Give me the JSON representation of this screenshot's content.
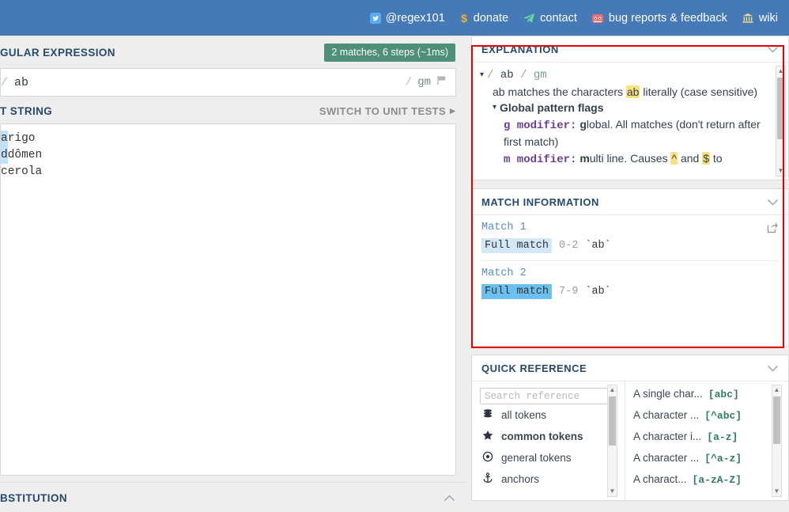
{
  "topnav": {
    "links": [
      {
        "icon": "twitter-icon",
        "label": "@regex101"
      },
      {
        "icon": "dollar-icon",
        "label": "donate"
      },
      {
        "icon": "telegram-icon",
        "label": "contact"
      },
      {
        "icon": "github-icon",
        "label": "bug reports & feedback"
      },
      {
        "icon": "bank-icon",
        "label": "wiki"
      }
    ]
  },
  "regex_section": {
    "title": "GULAR EXPRESSION",
    "match_badge": "2 matches, 6 steps (~1ms)",
    "slash": "/",
    "pattern": "ab",
    "flags_slash": "/",
    "flags": "gm",
    "flag_icon": "flag-icon"
  },
  "test_section": {
    "title": "T STRING",
    "switch_label": "SWITCH TO UNIT TESTS",
    "lines": [
      {
        "highlight": "a",
        "rest": "rigo"
      },
      {
        "highlight": "d",
        "rest": "dômen"
      },
      {
        "highlight": "",
        "rest": "cerola"
      }
    ]
  },
  "substitution_section": {
    "title": "BSTITUTION",
    "chevron": "chevron-up-icon"
  },
  "explanation": {
    "title": "EXPLANATION",
    "chevron": "chevron-down-icon",
    "header": {
      "slash1": "/",
      "pattern": "ab",
      "slash2": "/",
      "flags": "gm"
    },
    "line_literal_a": "ab",
    "line_literal_b": " matches the characters ",
    "line_literal_hl": "ab",
    "line_literal_c": " literally (case sensitive)",
    "flags_group": "Global pattern flags",
    "g_mod_key": "g modifier",
    "g_mod_colon": ":",
    "g_mod_bold": "g",
    "g_mod_text": "lobal. All matches (don't return after first match)",
    "m_mod_key": "m modifier",
    "m_mod_colon": ":",
    "m_mod_bold": "m",
    "m_mod_text_a": "ulti line. Causes ",
    "m_mod_caret": "^",
    "m_mod_text_b": " and ",
    "m_mod_dollar": "$",
    "m_mod_text_c": " to"
  },
  "match_information": {
    "title": "MATCH INFORMATION",
    "chevron": "chevron-down-icon",
    "share_icon": "share-icon",
    "matches": [
      {
        "label": "Match 1",
        "full_match": "Full match",
        "range": "0-2",
        "value": "`ab`"
      },
      {
        "label": "Match 2",
        "full_match": "Full match",
        "range": "7-9",
        "value": "`ab`"
      }
    ]
  },
  "quick_reference": {
    "title": "QUICK REFERENCE",
    "chevron": "chevron-down-icon",
    "search_placeholder": "Search reference",
    "search_value": "",
    "categories": [
      {
        "icon": "stack-icon",
        "label": "all tokens",
        "selected": false
      },
      {
        "icon": "star-icon",
        "label": "common tokens",
        "selected": true
      },
      {
        "icon": "target-icon",
        "label": "general tokens",
        "selected": false
      },
      {
        "icon": "anchor-icon",
        "label": "anchors",
        "selected": false
      }
    ],
    "references": [
      {
        "desc": "A single char...",
        "token": "[abc]"
      },
      {
        "desc": "A character ...",
        "token": "[^abc]"
      },
      {
        "desc": "A character i...",
        "token": "[a-z]"
      },
      {
        "desc": "A character ...",
        "token": "[^a-z]"
      },
      {
        "desc": "A charact...",
        "token": "[a-zA-Z]"
      }
    ]
  },
  "colors": {
    "nav_blue": "#4579b8",
    "badge_green": "#4d9077",
    "heading_navy": "#27496d",
    "annotation_red": "#e50000",
    "match_highlight": "#bfe1fb",
    "token_green": "#2f7d5b"
  }
}
